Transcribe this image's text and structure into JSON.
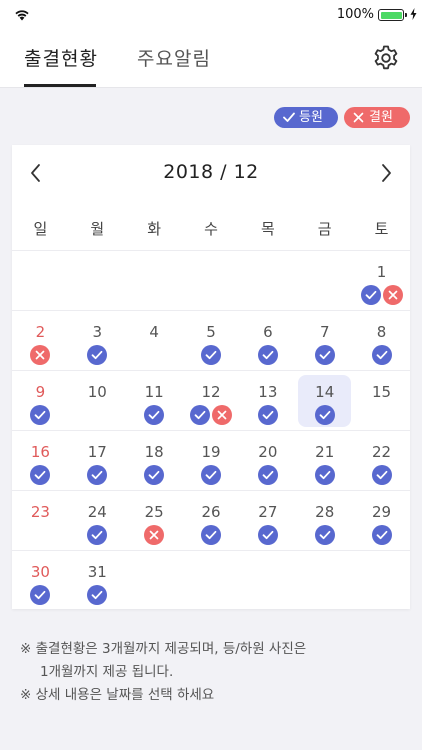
{
  "status_bar": {
    "battery_percent": "100%",
    "battery_level": 1.0
  },
  "header": {
    "tabs": [
      {
        "label": "출결현황",
        "active": true
      },
      {
        "label": "주요알림",
        "active": false
      }
    ]
  },
  "legend": {
    "present_label": "등원",
    "absent_label": "결원"
  },
  "calendar": {
    "title": "2018 / 12",
    "weekdays": [
      "일",
      "월",
      "화",
      "수",
      "목",
      "금",
      "토"
    ],
    "days": [
      {
        "d": "1",
        "marks": [
          "present",
          "absent"
        ]
      },
      {
        "d": "2",
        "marks": [
          "absent"
        ]
      },
      {
        "d": "3",
        "marks": [
          "present"
        ]
      },
      {
        "d": "4",
        "marks": []
      },
      {
        "d": "5",
        "marks": [
          "present"
        ]
      },
      {
        "d": "6",
        "marks": [
          "present"
        ]
      },
      {
        "d": "7",
        "marks": [
          "present"
        ]
      },
      {
        "d": "8",
        "marks": [
          "present"
        ]
      },
      {
        "d": "9",
        "marks": [
          "present"
        ]
      },
      {
        "d": "10",
        "marks": []
      },
      {
        "d": "11",
        "marks": [
          "present"
        ]
      },
      {
        "d": "12",
        "marks": [
          "present",
          "absent"
        ]
      },
      {
        "d": "13",
        "marks": [
          "present"
        ]
      },
      {
        "d": "14",
        "marks": [
          "present"
        ],
        "today": true
      },
      {
        "d": "15",
        "marks": []
      },
      {
        "d": "16",
        "marks": [
          "present"
        ]
      },
      {
        "d": "17",
        "marks": [
          "present"
        ]
      },
      {
        "d": "18",
        "marks": [
          "present"
        ]
      },
      {
        "d": "19",
        "marks": [
          "present"
        ]
      },
      {
        "d": "20",
        "marks": [
          "present"
        ]
      },
      {
        "d": "21",
        "marks": [
          "present"
        ]
      },
      {
        "d": "22",
        "marks": [
          "present"
        ]
      },
      {
        "d": "23",
        "marks": []
      },
      {
        "d": "24",
        "marks": [
          "present"
        ]
      },
      {
        "d": "25",
        "marks": [
          "absent"
        ]
      },
      {
        "d": "26",
        "marks": [
          "present"
        ]
      },
      {
        "d": "27",
        "marks": [
          "present"
        ]
      },
      {
        "d": "28",
        "marks": [
          "present"
        ]
      },
      {
        "d": "29",
        "marks": [
          "present"
        ]
      },
      {
        "d": "30",
        "marks": [
          "present"
        ]
      },
      {
        "d": "31",
        "marks": [
          "present"
        ]
      }
    ]
  },
  "notes": [
    "※ 출결현황은 3개월까지 제공되며, 등/하원 사진은",
    "1개월까지 제공 됩니다.",
    "※ 상세 내용은 날짜를 선택 하세요"
  ],
  "colors": {
    "present": "#5868cf",
    "absent": "#ef6a6a",
    "sunday": "#e05a5a",
    "today_bg": "#e9ebfa"
  }
}
